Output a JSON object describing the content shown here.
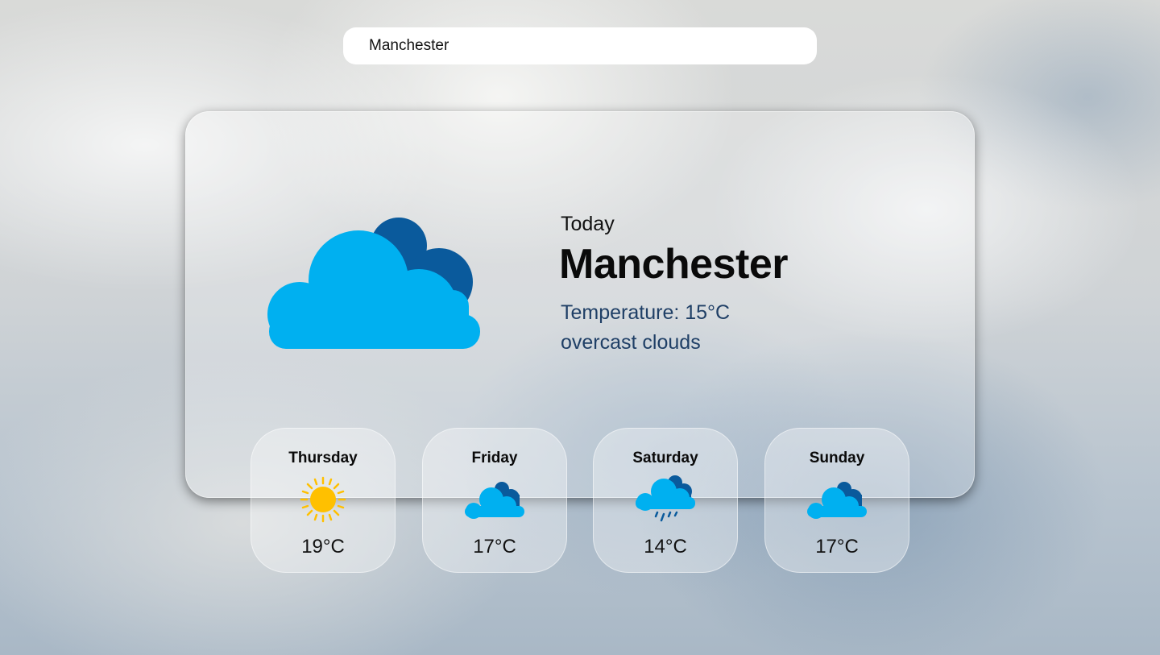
{
  "search": {
    "value": "Manchester"
  },
  "current": {
    "label": "Today",
    "city": "Manchester",
    "temperature": "Temperature: 15°C",
    "description": "overcast clouds",
    "icon": "overcast-clouds-icon"
  },
  "forecast": [
    {
      "day": "Thursday",
      "temp": "19°C",
      "icon": "sun-icon"
    },
    {
      "day": "Friday",
      "temp": "17°C",
      "icon": "cloud-icon"
    },
    {
      "day": "Saturday",
      "temp": "14°C",
      "icon": "rain-cloud-icon"
    },
    {
      "day": "Sunday",
      "temp": "17°C",
      "icon": "cloud-icon"
    }
  ],
  "colors": {
    "cloud_light": "#00b0f0",
    "cloud_dark": "#0a5a9c",
    "sun": "#ffc000"
  }
}
